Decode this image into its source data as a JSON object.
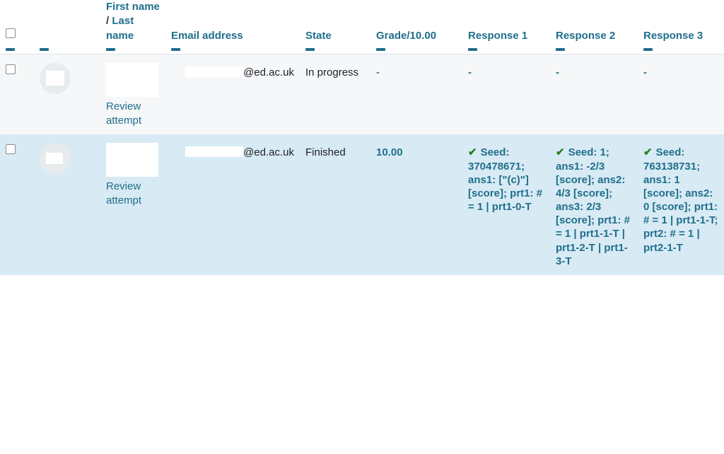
{
  "table": {
    "columns": [
      {
        "key": "select",
        "label": "",
        "sort_dash": "–"
      },
      {
        "key": "picture",
        "label": "",
        "sort_dash": "–"
      },
      {
        "key": "name",
        "label_line1": "First",
        "label_line2": "name",
        "label_sep": "/",
        "label_line3": "Last",
        "label_line4": "name",
        "sort_dash": "–"
      },
      {
        "key": "email",
        "label": "Email address",
        "sort_dash": "–"
      },
      {
        "key": "state",
        "label": "State",
        "sort_dash": "–"
      },
      {
        "key": "grade",
        "label": "Grade/10.00",
        "sort_dash": "–"
      },
      {
        "key": "resp1",
        "label_line1": "Response",
        "label_line2": "1",
        "sort_dash": "–"
      },
      {
        "key": "resp2",
        "label_line1": "Response",
        "label_line2": "2",
        "sort_dash": "–"
      },
      {
        "key": "resp3",
        "label_line1": "Response",
        "label_line2": "3",
        "sort_dash": "–"
      }
    ],
    "rows": [
      {
        "selected": false,
        "email_domain": "@ed.ac.uk",
        "review_link": "Review attempt",
        "state": "In progress",
        "grade": "-",
        "grade_is_link": false,
        "responses": [
          {
            "tick": false,
            "text": "-"
          },
          {
            "tick": false,
            "text": "-"
          },
          {
            "tick": false,
            "text": "-"
          }
        ]
      },
      {
        "selected": true,
        "email_domain": "@ed.ac.uk",
        "review_link": "Review attempt",
        "state": "Finished",
        "grade": "10.00",
        "grade_is_link": true,
        "responses": [
          {
            "tick": true,
            "tick_glyph": "✔",
            "text": "Seed: 370478671; ans1: [\"(c)\"] [score]; prt1: # = 1 | prt1-0-T"
          },
          {
            "tick": true,
            "tick_glyph": "✔",
            "text": "Seed: 1; ans1: -2/3 [score]; ans2: 4/3 [score]; ans3: 2/3 [score]; prt1: # = 1 | prt1-1-T | prt1-2-T | prt1-3-T"
          },
          {
            "tick": true,
            "tick_glyph": "✔",
            "text": "Seed: 763138731; ans1: 1 [score]; ans2: 0 [score]; prt1: # = 1 | prt1-1-T; prt2: # = 1 | prt2-1-T"
          }
        ]
      }
    ]
  },
  "colors": {
    "link": "#1f6f8b",
    "tick_green": "#2e7d1e",
    "row_odd_bg": "#f6f7f8",
    "row_even_bg": "#d8eaf4",
    "text": "#1d2125"
  }
}
